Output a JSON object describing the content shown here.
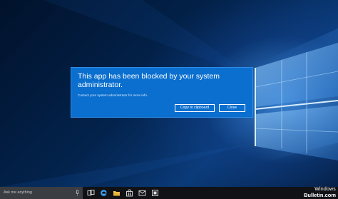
{
  "dialog": {
    "title": "This app has been blocked by your system administrator.",
    "message": "Contact your system administrator for more info.",
    "copy_button_label": "Copy to clipboard",
    "close_button_label": "Close",
    "accent_color": "#0a6fcf"
  },
  "taskbar": {
    "search_placeholder": "Ask me anything",
    "icons": [
      "task-view-icon",
      "edge-icon",
      "file-explorer-icon",
      "store-icon",
      "mail-icon",
      "app-icon"
    ]
  },
  "watermark": {
    "line1": "Windows",
    "line2": "Bulletin.com"
  }
}
